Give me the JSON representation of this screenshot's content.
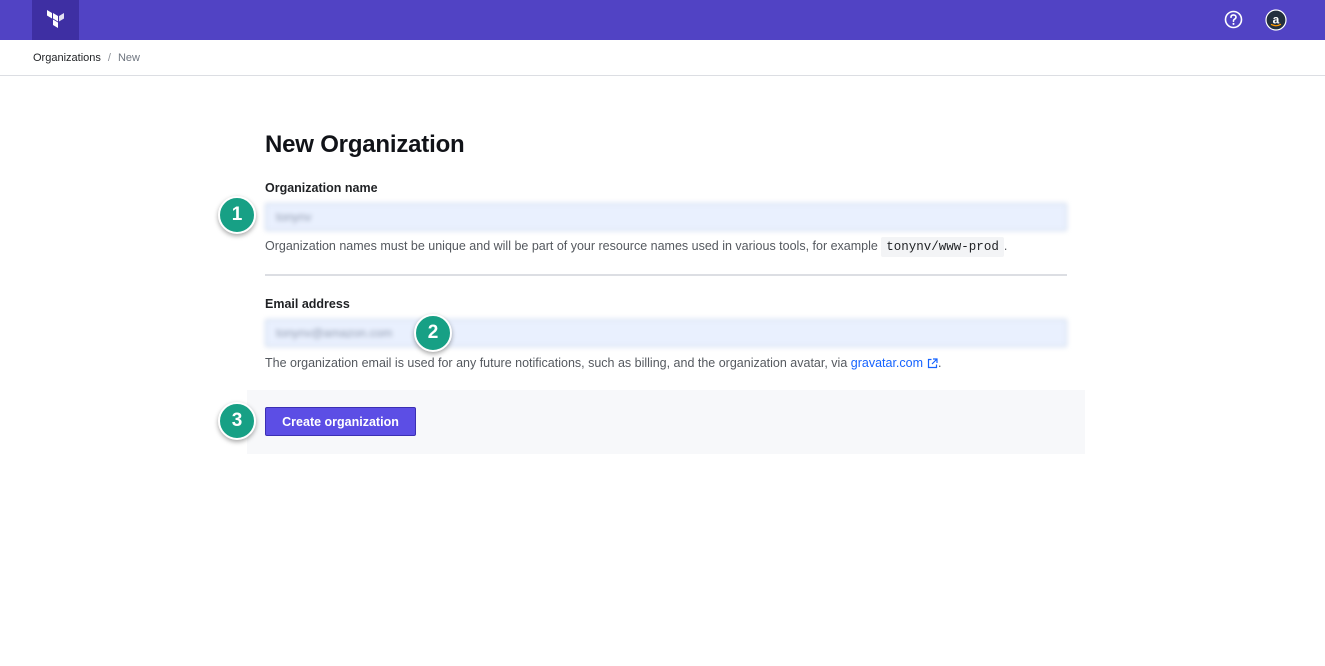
{
  "topbar": {
    "logo_icon": "terraform-logo-icon",
    "help_icon": "help-circle-icon",
    "account_icon": "amazon-account-icon",
    "account_glyph": "a",
    "brand_color": "#5143c4"
  },
  "breadcrumb": {
    "root": "Organizations",
    "separator": "/",
    "current": "New"
  },
  "form": {
    "title": "New Organization",
    "org_name": {
      "label": "Organization name",
      "value": "tonynv",
      "help_prefix": "Organization names must be unique and will be part of your resource names used in various tools, for example ",
      "help_code": "tonynv/www-prod",
      "help_suffix": "."
    },
    "email": {
      "label": "Email address",
      "value": "tonynv@amazon.com",
      "help_prefix": "The organization email is used for any future notifications, such as billing, and the organization avatar, via ",
      "help_link": "gravatar.com",
      "help_suffix": "."
    },
    "submit_label": "Create organization"
  },
  "steps": [
    "1",
    "2",
    "3"
  ],
  "colors": {
    "step_marker": "#17a085",
    "primary_button": "#5c4ee5",
    "link": "#1563ff"
  }
}
